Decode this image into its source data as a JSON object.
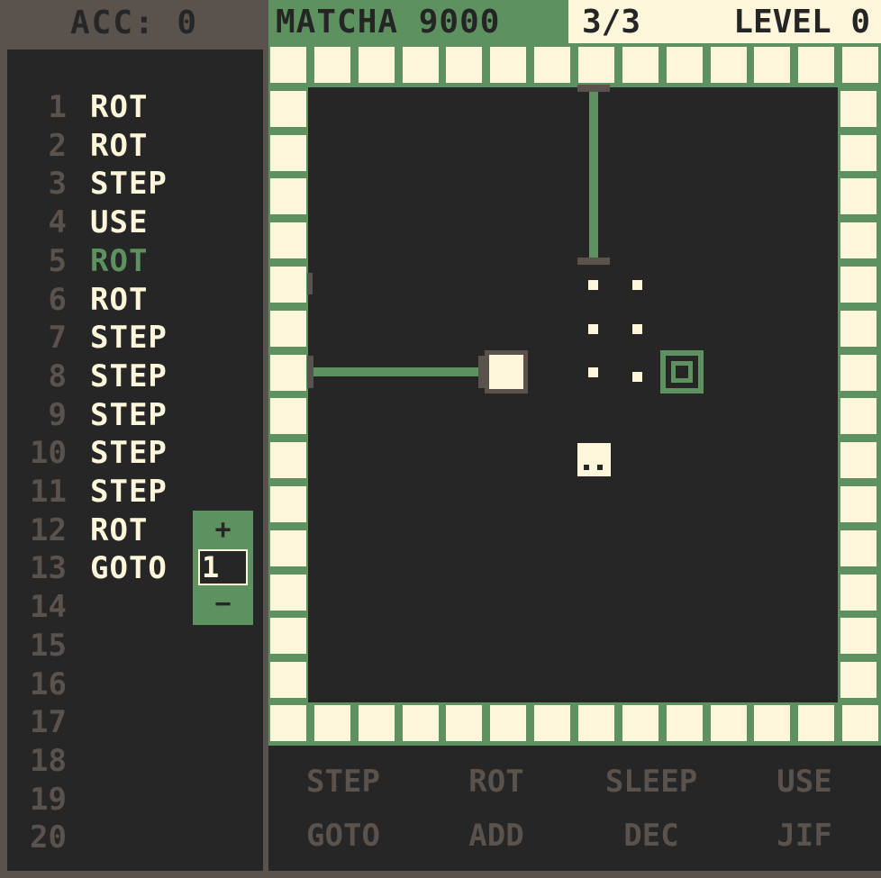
{
  "header": {
    "acc_label": "ACC: 0",
    "title": "MATCHA 9000",
    "progress": "3/3",
    "level": "LEVEL 0"
  },
  "program": {
    "lines": [
      {
        "num": "1",
        "instr": "ROT"
      },
      {
        "num": "2",
        "instr": "ROT"
      },
      {
        "num": "3",
        "instr": "STEP"
      },
      {
        "num": "4",
        "instr": "USE"
      },
      {
        "num": "5",
        "instr": "ROT",
        "active": true
      },
      {
        "num": "6",
        "instr": "ROT"
      },
      {
        "num": "7",
        "instr": "STEP"
      },
      {
        "num": "8",
        "instr": "STEP"
      },
      {
        "num": "9",
        "instr": "STEP"
      },
      {
        "num": "10",
        "instr": "STEP"
      },
      {
        "num": "11",
        "instr": "STEP"
      },
      {
        "num": "12",
        "instr": "ROT"
      },
      {
        "num": "13",
        "instr": "GOTO"
      },
      {
        "num": "14",
        "instr": ""
      },
      {
        "num": "15",
        "instr": ""
      },
      {
        "num": "16",
        "instr": ""
      },
      {
        "num": "17",
        "instr": ""
      },
      {
        "num": "18",
        "instr": ""
      },
      {
        "num": "19",
        "instr": ""
      },
      {
        "num": "20",
        "instr": ""
      }
    ],
    "stepper": {
      "plus": "+",
      "value": "1",
      "minus": "−"
    }
  },
  "palette": {
    "row1": [
      "STEP",
      "ROT",
      "SLEEP",
      "USE"
    ],
    "row2": [
      "GOTO",
      "ADD",
      "DEC",
      "JIF"
    ]
  },
  "colors": {
    "dark": "#262626",
    "cream": "#fdf6da",
    "green": "#5e9160",
    "taupe": "#5a524c"
  },
  "icons": [
    "robot-icon",
    "target-icon",
    "box-icon",
    "dot-marker-icon",
    "pipe-icon"
  ]
}
